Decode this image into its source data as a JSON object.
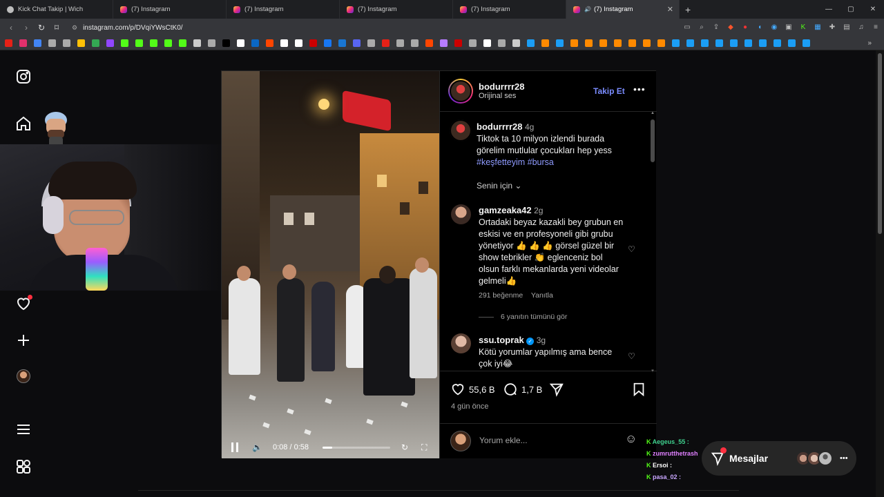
{
  "browser": {
    "tabs": [
      {
        "title": "Kick Chat Takip | Wich",
        "icon": "globe-icon",
        "active": false
      },
      {
        "title": "(7) Instagram",
        "icon": "instagram-icon",
        "active": false
      },
      {
        "title": "(7) Instagram",
        "icon": "instagram-icon",
        "active": false
      },
      {
        "title": "(7) Instagram",
        "icon": "instagram-icon",
        "active": false
      },
      {
        "title": "(7) Instagram",
        "icon": "instagram-icon",
        "active": false
      },
      {
        "title": "(7) Instagram",
        "icon": "instagram-icon",
        "active": true
      }
    ],
    "url": "instagram.com/p/DVqiYWsCtK0/",
    "bookmark_colors": [
      "#e62117",
      "#e1306c",
      "#4285f4",
      "#aaaaaa",
      "#aaaaaa",
      "#ffc107",
      "#34a853",
      "#9146ff",
      "#53fc18",
      "#53fc18",
      "#53fc18",
      "#53fc18",
      "#53fc18",
      "#cccccc",
      "#aaaaaa",
      "#000000",
      "#ffffff",
      "#0b67c2",
      "#ff4500",
      "#ffffff",
      "#ffffff",
      "#cc0000",
      "#1877f2",
      "#1976d2",
      "#5865f2",
      "#aaaaaa",
      "#e62117",
      "#aaaaaa",
      "#aaaaaa",
      "#ff4500",
      "#b67cff",
      "#cc0000",
      "#aaaaaa",
      "#ffffff",
      "#aaaaaa",
      "#cccccc",
      "#1b9ef5",
      "#ff8a00",
      "#1b9ef5",
      "#ff8a00",
      "#ff8a00",
      "#ff8a00",
      "#ff8a00",
      "#ff8a00",
      "#ff8a00",
      "#ff8a00",
      "#1b9ef5",
      "#1b9ef5",
      "#1b9ef5",
      "#1b9ef5",
      "#1b9ef5",
      "#1b9ef5",
      "#1b9ef5",
      "#1b9ef5",
      "#1b9ef5",
      "#1b9ef5"
    ]
  },
  "post": {
    "username": "bodurrrr28",
    "audio": "Orijinal ses",
    "follow_label": "Takip Et",
    "caption": {
      "username": "bodurrrr28",
      "age": "4g",
      "text": "Tiktok ta 10 milyon izlendi burada görelim mutlular çocukları hep yess",
      "hashtags": "#keşfetteyim #bursa"
    },
    "filter_label": "Senin için",
    "comments": [
      {
        "username": "gamzeaka42",
        "age": "2g",
        "text": "Ortadaki beyaz kazakli bey grubun en eskisi ve en profesyoneli gibi grubu yönetiyor 👍 👍 👍 görsel güzel bir show tebrikler 👏 eglenceniz bol olsun farklı mekanlarda yeni videolar gelmeli👍",
        "likes": "291 beğenme",
        "reply": "Yanıtla",
        "view_replies": "6 yanıtın tümünü gör"
      },
      {
        "username": "ssu.toprak",
        "verified": true,
        "age": "3g",
        "text": "Kötü yorumlar yapılmış ama bence çok iyi😂"
      }
    ],
    "likes_count": "55,6 B",
    "comments_count": "1,7 B",
    "posted": "4 gün önce",
    "add_comment_placeholder": "Yorum ekle...",
    "video_time": "0:08 / 0:58",
    "video_progress": 0.138
  },
  "chat": [
    {
      "user": "Aegeus_55 :",
      "color": "#3fd28f",
      "badge": "K"
    },
    {
      "user": "zumrutthetrash",
      "color": "#e080ff",
      "badge": "K"
    },
    {
      "user": "Ersoi :",
      "color": "#ffffff",
      "badge": "K"
    },
    {
      "user": "pasa_02 :",
      "color": "#c9a7ff",
      "badge": "K"
    }
  ],
  "messages_label": "Mesajlar"
}
